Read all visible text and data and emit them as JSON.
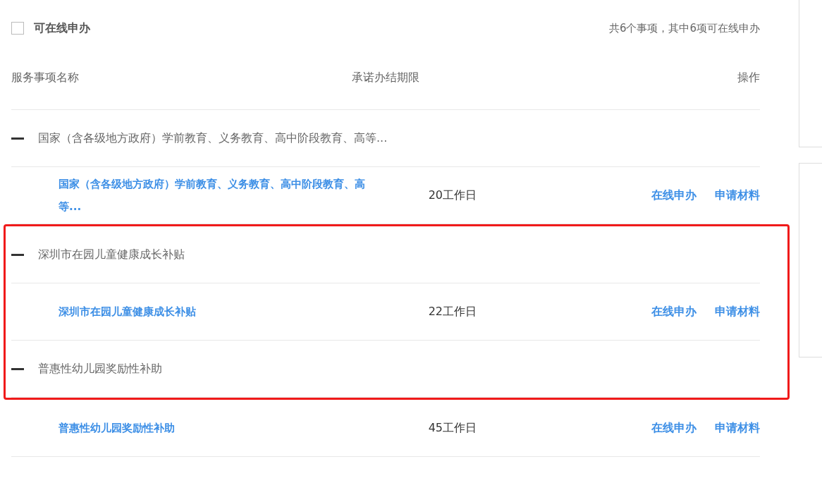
{
  "filter": {
    "label": "可在线申办",
    "checked": false
  },
  "summary": "共6个事项，其中6项可在线申办",
  "columns": [
    "服务事项名称",
    "承诺办结期限",
    "操作"
  ],
  "rows": [
    {
      "kind": "group",
      "title": "国家（含各级地方政府）学前教育、义务教育、高中阶段教育、高等...",
      "expanded": true,
      "highlighted": false
    },
    {
      "kind": "item",
      "name": "国家（含各级地方政府）学前教育、义务教育、高中阶段教育、高等...",
      "deadline": "20工作日",
      "actions": [
        "在线申办",
        "申请材料"
      ],
      "highlighted": false
    },
    {
      "kind": "group",
      "title": "深圳市在园儿童健康成长补贴",
      "expanded": true,
      "highlighted": true
    },
    {
      "kind": "item",
      "name": "深圳市在园儿童健康成长补贴",
      "deadline": "22工作日",
      "actions": [
        "在线申办",
        "申请材料"
      ],
      "highlighted": true
    },
    {
      "kind": "group",
      "title": "普惠性幼儿园奖励性补助",
      "expanded": true,
      "highlighted": true
    },
    {
      "kind": "item",
      "name": "普惠性幼儿园奖励性补助",
      "deadline": "45工作日",
      "actions": [
        "在线申办",
        "申请材料"
      ],
      "highlighted": false
    }
  ]
}
